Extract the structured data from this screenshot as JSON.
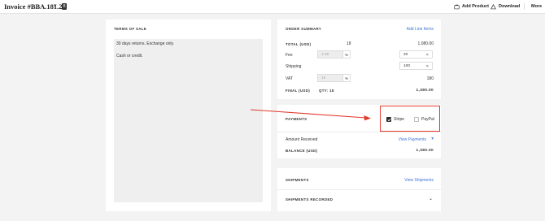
{
  "header": {
    "title": "Invoice #BBA.181.2",
    "badge": "8",
    "add_product": "Add Product",
    "download": "Download",
    "more": "More"
  },
  "terms": {
    "heading": "TERMS OF SALE",
    "line1": "30 days returns. Exchange only.",
    "line2": "Cash or credit."
  },
  "order_summary": {
    "heading": "ORDER SUMMARY",
    "add_line_items": "Add Line Items",
    "total_label": "TOTAL (USD)",
    "total_qty": "18",
    "total_amount": "1,080.00",
    "fee_label": "Fee",
    "fee_pct": "1.85",
    "pct_symbol": "%",
    "fee_value": "20",
    "shipping_label": "Shipping",
    "shipping_value": "100",
    "vat_label": "VAT",
    "vat_pct": "15",
    "vat_amount": "180",
    "clear_symbol": "×",
    "final_label": "FINAL (USD)",
    "final_qty": "QTY: 18",
    "final_amount": "1,380.00"
  },
  "payments": {
    "heading": "PAYMENTS",
    "stripe_label": "Stripe",
    "stripe_checked": true,
    "paypal_label": "PayPal",
    "paypal_checked": false,
    "amount_received_label": "Amount Received",
    "view_payments": "View Payments",
    "balance_label": "BALANCE (USD)",
    "balance_amount": "1,380.00"
  },
  "shipments": {
    "heading": "SHIPMENTS",
    "view_shipments": "View Shipments",
    "recorded_label": "SHIPMENTS RECORDED"
  },
  "colors": {
    "accent": "#3c74d6",
    "highlight_box": "#e33a2c",
    "arrow": "#e33a2c"
  }
}
